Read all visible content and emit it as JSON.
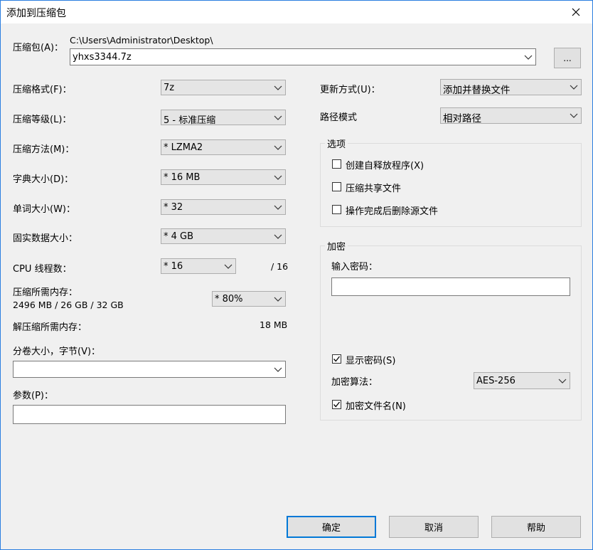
{
  "window": {
    "title": "添加到压缩包"
  },
  "archive": {
    "label": "压缩包(A)：",
    "path": "C:\\Users\\Administrator\\Desktop\\",
    "value": "yhxs3344.7z",
    "browse_label": "..."
  },
  "left": {
    "format_label": "压缩格式(F)：",
    "format_value": "7z",
    "level_label": "压缩等级(L)：",
    "level_value": "5 - 标准压缩",
    "method_label": "压缩方法(M)：",
    "method_value": "* LZMA2",
    "dict_label": "字典大小(D)：",
    "dict_value": "* 16 MB",
    "word_label": "单词大小(W)：",
    "word_value": "* 32",
    "solid_label": "固实数据大小：",
    "solid_value": "* 4 GB",
    "cpu_label": "CPU 线程数：",
    "cpu_value": "* 16",
    "cpu_total": "/ 16",
    "mem_comp_label": "压缩所需内存：",
    "mem_comp_value": "2496 MB / 26 GB / 32 GB",
    "mem_percent": "* 80%",
    "mem_decomp_label": "解压缩所需内存：",
    "mem_decomp_value": "18 MB",
    "volume_label": "分卷大小，字节(V)：",
    "volume_value": "",
    "params_label": "参数(P)：",
    "params_value": ""
  },
  "right": {
    "update_label": "更新方式(U)：",
    "update_value": "添加并替换文件",
    "path_label": "路径模式",
    "path_value": "相对路径",
    "options_title": "选项",
    "opt_sfx": "创建自释放程序(X)",
    "opt_shared": "压缩共享文件",
    "opt_delete": "操作完成后删除源文件",
    "encrypt_title": "加密",
    "password_label": "输入密码：",
    "password_value": "",
    "show_password": "显示密码(S)",
    "algo_label": "加密算法：",
    "algo_value": "AES-256",
    "encrypt_names": "加密文件名(N)"
  },
  "buttons": {
    "ok": "确定",
    "cancel": "取消",
    "help": "帮助"
  }
}
